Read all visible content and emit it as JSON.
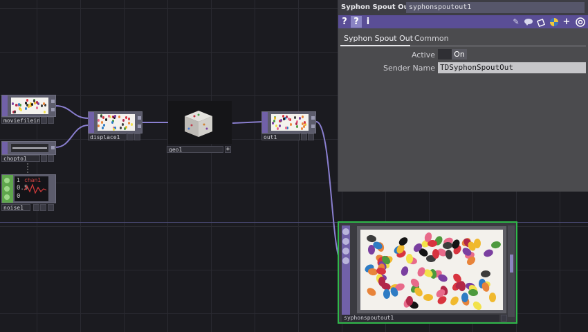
{
  "network": {
    "nodes": {
      "moviefilein": {
        "name": "moviefilein1",
        "type": "TOP"
      },
      "displace": {
        "name": "displace1",
        "type": "TOP"
      },
      "geo": {
        "name": "geo1",
        "type": "COMP"
      },
      "out": {
        "name": "out1",
        "type": "TOP"
      },
      "chopto": {
        "name": "chopto1",
        "type": "TOP"
      },
      "noise": {
        "name": "noise1",
        "type": "CHOP",
        "graph_labels": {
          "top": "1",
          "mid": "0.5",
          "bottom": "0",
          "channel": "chan1"
        }
      },
      "syphonspoutout": {
        "name": "syphonspoutout1",
        "type": "TOP"
      }
    }
  },
  "panel": {
    "op_type": "Syphon Spout Out",
    "op_name": "syphonspoutout1",
    "icons": {
      "help": "?",
      "python_help": "?",
      "info": "i",
      "edit": "✎",
      "comment": "speech-bubble-icon",
      "clone": "clone-icon",
      "python": "python-icon",
      "add": "+",
      "target": "target-icon"
    },
    "tabs": [
      {
        "label": "Syphon Spout Out",
        "selected": true
      },
      {
        "label": "Common",
        "selected": false
      }
    ],
    "params": {
      "active": {
        "label": "Active",
        "value": "On"
      },
      "sender_name": {
        "label": "Sender Name",
        "value": "TDSyphonSpoutOut"
      }
    }
  },
  "colors": {
    "top_operator": "#7161a8",
    "chop_operator": "#5fa64d",
    "selected_border": "#2fb84a",
    "wire": "#8a7fd0",
    "panel_bg": "#4b4b4e",
    "iconbar_bg": "#5a4e96"
  }
}
